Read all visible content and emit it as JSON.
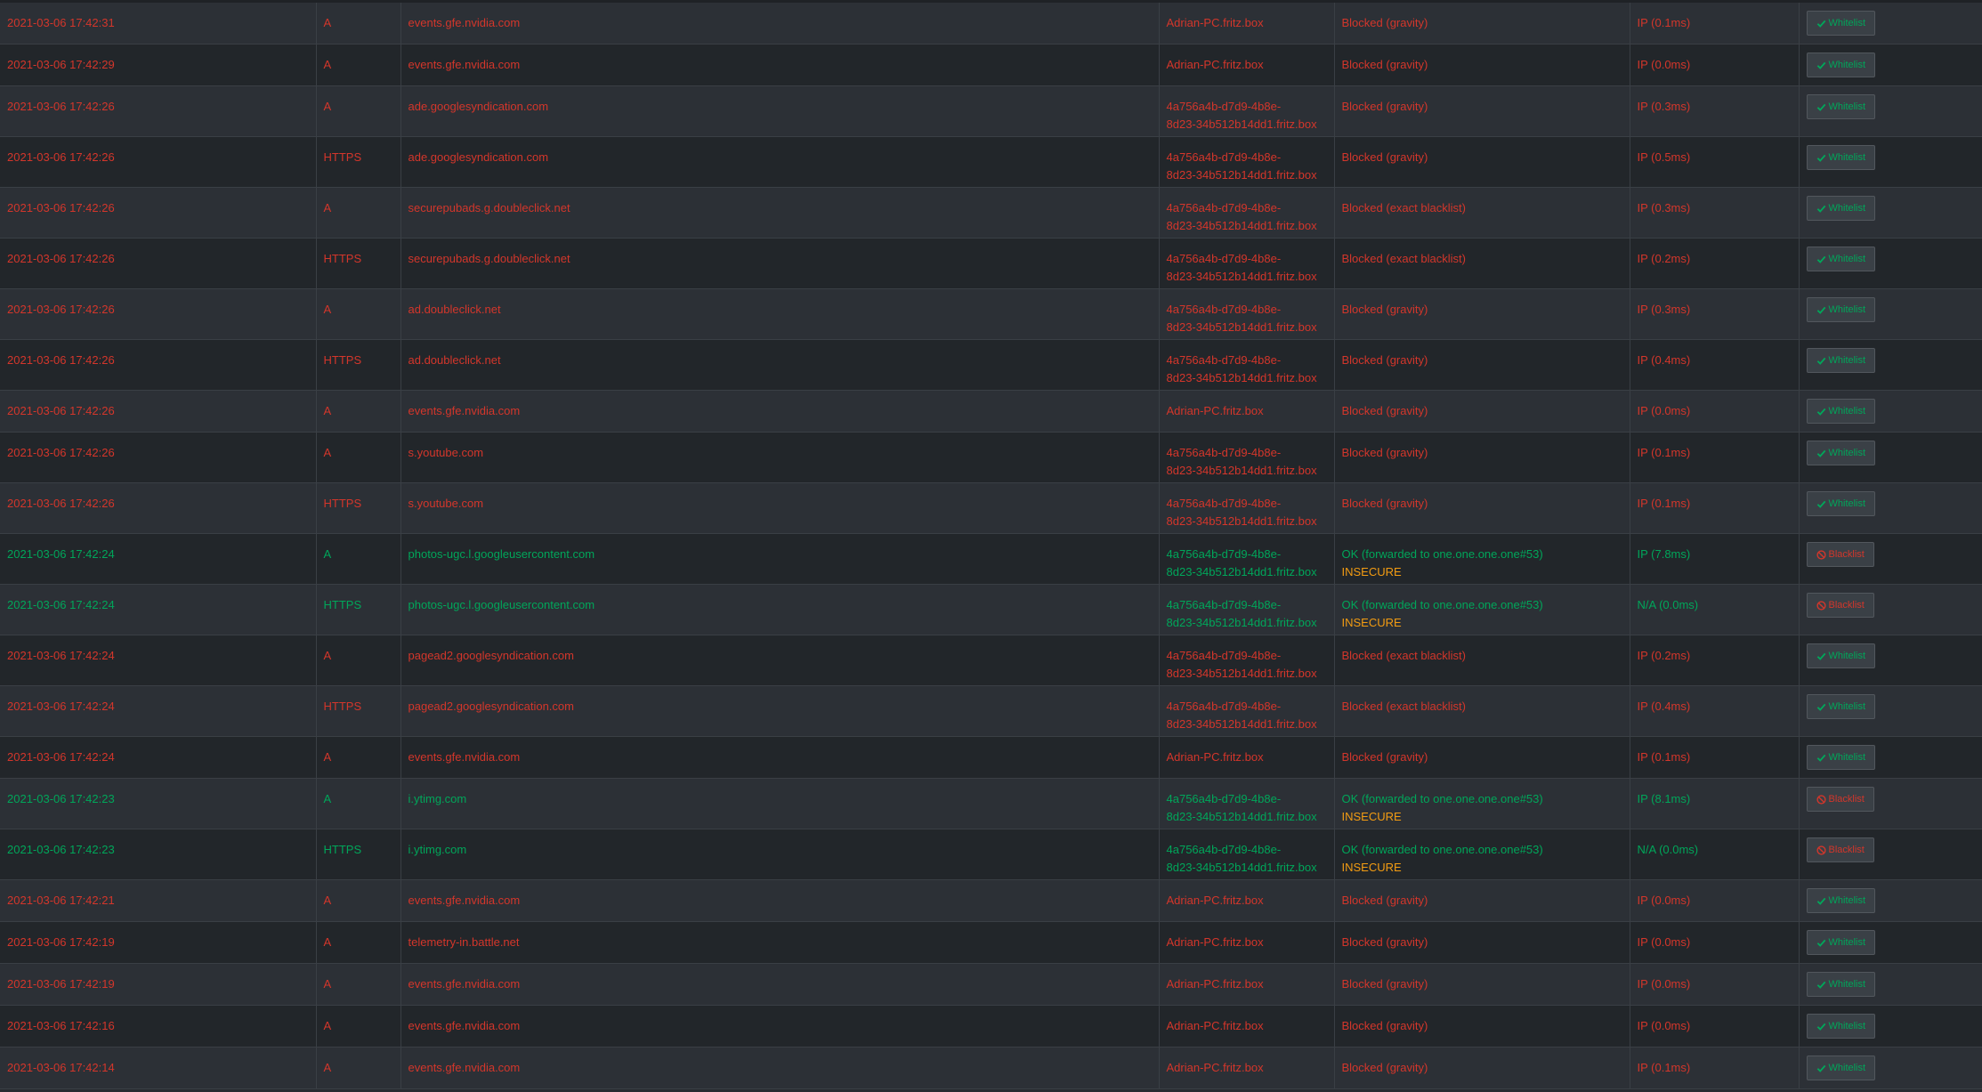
{
  "colors": {
    "blocked": "#d3362b",
    "allowed": "#00a65a",
    "insecure": "#f39c12",
    "row_odd": "#2c3036",
    "row_even": "#22262a"
  },
  "rows": [
    {
      "time": "2021-03-06 17:42:31",
      "type": "A",
      "domain": "events.gfe.nvidia.com",
      "client": [
        "Adrian-PC.fritz.box"
      ],
      "status": "Blocked (gravity)",
      "reply": "IP (0.1ms)",
      "action": "Whitelist",
      "action_icon": "check-icon",
      "blocked": true
    },
    {
      "time": "2021-03-06 17:42:29",
      "type": "A",
      "domain": "events.gfe.nvidia.com",
      "client": [
        "Adrian-PC.fritz.box"
      ],
      "status": "Blocked (gravity)",
      "reply": "IP (0.0ms)",
      "action": "Whitelist",
      "action_icon": "check-icon",
      "blocked": true
    },
    {
      "time": "2021-03-06 17:42:26",
      "type": "A",
      "domain": "ade.googlesyndication.com",
      "client": [
        "4a756a4b-d7d9-4b8e-",
        "8d23-34b512b14dd1.fritz.box"
      ],
      "status": "Blocked (gravity)",
      "reply": "IP (0.3ms)",
      "action": "Whitelist",
      "action_icon": "check-icon",
      "blocked": true
    },
    {
      "time": "2021-03-06 17:42:26",
      "type": "HTTPS",
      "domain": "ade.googlesyndication.com",
      "client": [
        "4a756a4b-d7d9-4b8e-",
        "8d23-34b512b14dd1.fritz.box"
      ],
      "status": "Blocked (gravity)",
      "reply": "IP (0.5ms)",
      "action": "Whitelist",
      "action_icon": "check-icon",
      "blocked": true
    },
    {
      "time": "2021-03-06 17:42:26",
      "type": "A",
      "domain": "securepubads.g.doubleclick.net",
      "client": [
        "4a756a4b-d7d9-4b8e-",
        "8d23-34b512b14dd1.fritz.box"
      ],
      "status": "Blocked (exact blacklist)",
      "reply": "IP (0.3ms)",
      "action": "Whitelist",
      "action_icon": "check-icon",
      "blocked": true
    },
    {
      "time": "2021-03-06 17:42:26",
      "type": "HTTPS",
      "domain": "securepubads.g.doubleclick.net",
      "client": [
        "4a756a4b-d7d9-4b8e-",
        "8d23-34b512b14dd1.fritz.box"
      ],
      "status": "Blocked (exact blacklist)",
      "reply": "IP (0.2ms)",
      "action": "Whitelist",
      "action_icon": "check-icon",
      "blocked": true
    },
    {
      "time": "2021-03-06 17:42:26",
      "type": "A",
      "domain": "ad.doubleclick.net",
      "client": [
        "4a756a4b-d7d9-4b8e-",
        "8d23-34b512b14dd1.fritz.box"
      ],
      "status": "Blocked (gravity)",
      "reply": "IP (0.3ms)",
      "action": "Whitelist",
      "action_icon": "check-icon",
      "blocked": true
    },
    {
      "time": "2021-03-06 17:42:26",
      "type": "HTTPS",
      "domain": "ad.doubleclick.net",
      "client": [
        "4a756a4b-d7d9-4b8e-",
        "8d23-34b512b14dd1.fritz.box"
      ],
      "status": "Blocked (gravity)",
      "reply": "IP (0.4ms)",
      "action": "Whitelist",
      "action_icon": "check-icon",
      "blocked": true
    },
    {
      "time": "2021-03-06 17:42:26",
      "type": "A",
      "domain": "events.gfe.nvidia.com",
      "client": [
        "Adrian-PC.fritz.box"
      ],
      "status": "Blocked (gravity)",
      "reply": "IP (0.0ms)",
      "action": "Whitelist",
      "action_icon": "check-icon",
      "blocked": true
    },
    {
      "time": "2021-03-06 17:42:26",
      "type": "A",
      "domain": "s.youtube.com",
      "client": [
        "4a756a4b-d7d9-4b8e-",
        "8d23-34b512b14dd1.fritz.box"
      ],
      "status": "Blocked (gravity)",
      "reply": "IP (0.1ms)",
      "action": "Whitelist",
      "action_icon": "check-icon",
      "blocked": true
    },
    {
      "time": "2021-03-06 17:42:26",
      "type": "HTTPS",
      "domain": "s.youtube.com",
      "client": [
        "4a756a4b-d7d9-4b8e-",
        "8d23-34b512b14dd1.fritz.box"
      ],
      "status": "Blocked (gravity)",
      "reply": "IP (0.1ms)",
      "action": "Whitelist",
      "action_icon": "check-icon",
      "blocked": true
    },
    {
      "time": "2021-03-06 17:42:24",
      "type": "A",
      "domain": "photos-ugc.l.googleusercontent.com",
      "client": [
        "4a756a4b-d7d9-4b8e-",
        "8d23-34b512b14dd1.fritz.box"
      ],
      "status": "OK (forwarded to one.one.one.one#53)",
      "status_extra": "INSECURE",
      "reply": "IP (7.8ms)",
      "action": "Blacklist",
      "action_icon": "ban-icon",
      "blocked": false
    },
    {
      "time": "2021-03-06 17:42:24",
      "type": "HTTPS",
      "domain": "photos-ugc.l.googleusercontent.com",
      "client": [
        "4a756a4b-d7d9-4b8e-",
        "8d23-34b512b14dd1.fritz.box"
      ],
      "status": "OK (forwarded to one.one.one.one#53)",
      "status_extra": "INSECURE",
      "reply": "N/A (0.0ms)",
      "action": "Blacklist",
      "action_icon": "ban-icon",
      "blocked": false
    },
    {
      "time": "2021-03-06 17:42:24",
      "type": "A",
      "domain": "pagead2.googlesyndication.com",
      "client": [
        "4a756a4b-d7d9-4b8e-",
        "8d23-34b512b14dd1.fritz.box"
      ],
      "status": "Blocked (exact blacklist)",
      "reply": "IP (0.2ms)",
      "action": "Whitelist",
      "action_icon": "check-icon",
      "blocked": true
    },
    {
      "time": "2021-03-06 17:42:24",
      "type": "HTTPS",
      "domain": "pagead2.googlesyndication.com",
      "client": [
        "4a756a4b-d7d9-4b8e-",
        "8d23-34b512b14dd1.fritz.box"
      ],
      "status": "Blocked (exact blacklist)",
      "reply": "IP (0.4ms)",
      "action": "Whitelist",
      "action_icon": "check-icon",
      "blocked": true
    },
    {
      "time": "2021-03-06 17:42:24",
      "type": "A",
      "domain": "events.gfe.nvidia.com",
      "client": [
        "Adrian-PC.fritz.box"
      ],
      "status": "Blocked (gravity)",
      "reply": "IP (0.1ms)",
      "action": "Whitelist",
      "action_icon": "check-icon",
      "blocked": true
    },
    {
      "time": "2021-03-06 17:42:23",
      "type": "A",
      "domain": "i.ytimg.com",
      "client": [
        "4a756a4b-d7d9-4b8e-",
        "8d23-34b512b14dd1.fritz.box"
      ],
      "status": "OK (forwarded to one.one.one.one#53)",
      "status_extra": "INSECURE",
      "reply": "IP (8.1ms)",
      "action": "Blacklist",
      "action_icon": "ban-icon",
      "blocked": false
    },
    {
      "time": "2021-03-06 17:42:23",
      "type": "HTTPS",
      "domain": "i.ytimg.com",
      "client": [
        "4a756a4b-d7d9-4b8e-",
        "8d23-34b512b14dd1.fritz.box"
      ],
      "status": "OK (forwarded to one.one.one.one#53)",
      "status_extra": "INSECURE",
      "reply": "N/A (0.0ms)",
      "action": "Blacklist",
      "action_icon": "ban-icon",
      "blocked": false
    },
    {
      "time": "2021-03-06 17:42:21",
      "type": "A",
      "domain": "events.gfe.nvidia.com",
      "client": [
        "Adrian-PC.fritz.box"
      ],
      "status": "Blocked (gravity)",
      "reply": "IP (0.0ms)",
      "action": "Whitelist",
      "action_icon": "check-icon",
      "blocked": true
    },
    {
      "time": "2021-03-06 17:42:19",
      "type": "A",
      "domain": "telemetry-in.battle.net",
      "client": [
        "Adrian-PC.fritz.box"
      ],
      "status": "Blocked (gravity)",
      "reply": "IP (0.0ms)",
      "action": "Whitelist",
      "action_icon": "check-icon",
      "blocked": true
    },
    {
      "time": "2021-03-06 17:42:19",
      "type": "A",
      "domain": "events.gfe.nvidia.com",
      "client": [
        "Adrian-PC.fritz.box"
      ],
      "status": "Blocked (gravity)",
      "reply": "IP (0.0ms)",
      "action": "Whitelist",
      "action_icon": "check-icon",
      "blocked": true
    },
    {
      "time": "2021-03-06 17:42:16",
      "type": "A",
      "domain": "events.gfe.nvidia.com",
      "client": [
        "Adrian-PC.fritz.box"
      ],
      "status": "Blocked (gravity)",
      "reply": "IP (0.0ms)",
      "action": "Whitelist",
      "action_icon": "check-icon",
      "blocked": true
    },
    {
      "time": "2021-03-06 17:42:14",
      "type": "A",
      "domain": "events.gfe.nvidia.com",
      "client": [
        "Adrian-PC.fritz.box"
      ],
      "status": "Blocked (gravity)",
      "reply": "IP (0.1ms)",
      "action": "Whitelist",
      "action_icon": "check-icon",
      "blocked": true
    }
  ]
}
